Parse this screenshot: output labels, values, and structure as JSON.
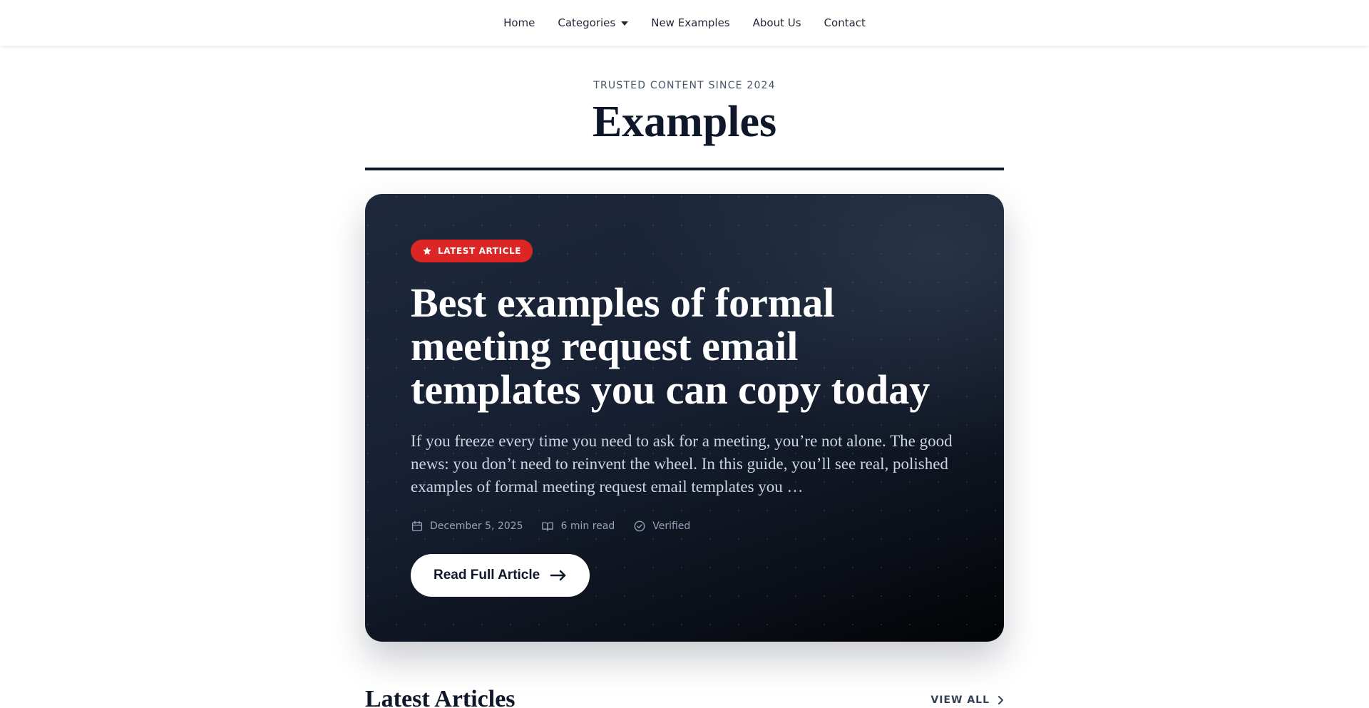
{
  "nav": {
    "items": [
      {
        "label": "Home"
      },
      {
        "label": "Categories",
        "has_dropdown": true
      },
      {
        "label": "New Examples"
      },
      {
        "label": "About Us"
      },
      {
        "label": "Contact"
      }
    ]
  },
  "header": {
    "eyebrow": "TRUSTED CONTENT SINCE 2024",
    "title": "Examples"
  },
  "featured": {
    "badge": "LATEST ARTICLE",
    "badge_icon": "star-icon",
    "title": "Best examples of formal meeting request email templates you can copy today",
    "excerpt": "If you freeze every time you need to ask for a meeting, you’re not alone. The good news: you don’t need to reinvent the wheel. In this guide, you’ll see real, polished examples of formal meeting request email templates you …",
    "date": "December 5, 2025",
    "read_time": "6 min read",
    "verified": "Verified",
    "cta": "Read Full Article"
  },
  "latest": {
    "heading": "Latest Articles",
    "view_all": "VIEW ALL"
  },
  "colors": {
    "badge_bg": "#dc2626",
    "card_bg_start": "#1e293b",
    "card_bg_end": "#020305",
    "text_dark": "#0f172a",
    "meta_text": "#94a3b8"
  }
}
